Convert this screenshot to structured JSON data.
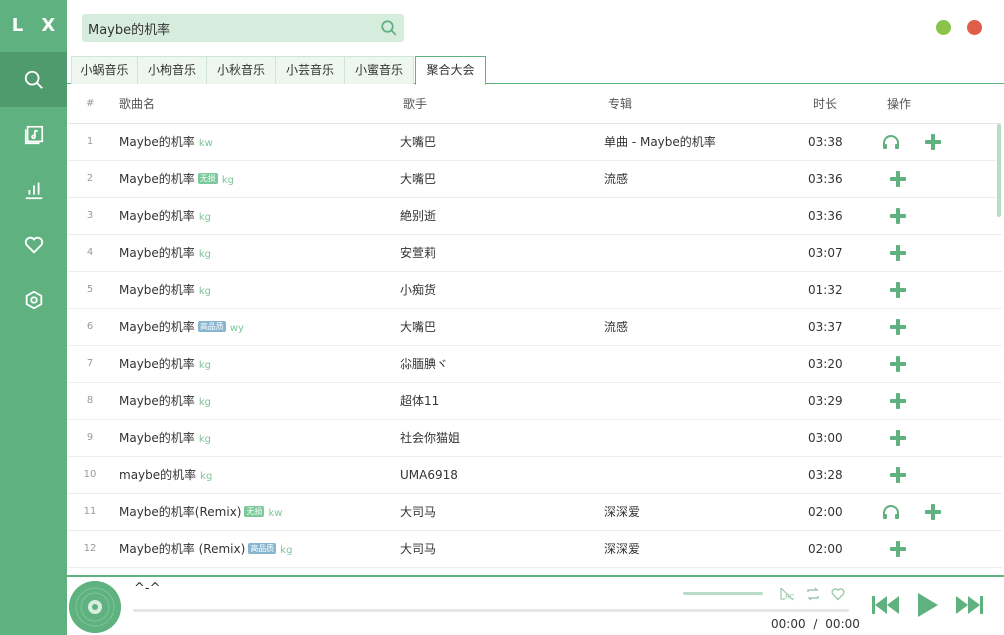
{
  "sidebar": {
    "logo": "L X",
    "items": [
      {
        "name": "search-icon"
      },
      {
        "name": "music-list-icon"
      },
      {
        "name": "chart-icon"
      },
      {
        "name": "heart-icon"
      },
      {
        "name": "settings-icon"
      }
    ]
  },
  "search": {
    "value": "Maybe的机率",
    "placeholder": ""
  },
  "tabs": [
    "小蜗音乐",
    "小枸音乐",
    "小秋音乐",
    "小芸音乐",
    "小蜜音乐",
    "聚合大会"
  ],
  "active_tab": 5,
  "table": {
    "headers": {
      "num": "#",
      "name": "歌曲名",
      "singer": "歌手",
      "album": "专辑",
      "duration": "时长",
      "ops": "操作"
    },
    "rows": [
      {
        "num": "1",
        "name": "Maybe的机率",
        "badge": "",
        "source": "kw",
        "singer": "大嘴巴",
        "album": "单曲 - Maybe的机率",
        "duration": "03:38",
        "listen": true
      },
      {
        "num": "2",
        "name": "Maybe的机率",
        "badge": "无损",
        "source": "kg",
        "singer": "大嘴巴",
        "album": "流感",
        "duration": "03:36",
        "listen": false
      },
      {
        "num": "3",
        "name": "Maybe的机率",
        "badge": "",
        "source": "kg",
        "singer": "絶别逝",
        "album": "",
        "duration": "03:36",
        "listen": false
      },
      {
        "num": "4",
        "name": "Maybe的机率",
        "badge": "",
        "source": "kg",
        "singer": "安萱莉",
        "album": "",
        "duration": "03:07",
        "listen": false
      },
      {
        "num": "5",
        "name": "Maybe的机率",
        "badge": "",
        "source": "kg",
        "singer": "小痴货",
        "album": "",
        "duration": "01:32",
        "listen": false
      },
      {
        "num": "6",
        "name": "Maybe的机率",
        "badge": "高品质",
        "source": "wy",
        "singer": "大嘴巴",
        "album": "流感",
        "duration": "03:37",
        "listen": false
      },
      {
        "num": "7",
        "name": "Maybe的机率",
        "badge": "",
        "source": "kg",
        "singer": "尛腼腆ヾ",
        "album": "",
        "duration": "03:20",
        "listen": false
      },
      {
        "num": "8",
        "name": "Maybe的机率",
        "badge": "",
        "source": "kg",
        "singer": "超体11",
        "album": "",
        "duration": "03:29",
        "listen": false
      },
      {
        "num": "9",
        "name": "Maybe的机率",
        "badge": "",
        "source": "kg",
        "singer": "社会你猫姐",
        "album": "",
        "duration": "03:00",
        "listen": false
      },
      {
        "num": "10",
        "name": "maybe的机率",
        "badge": "",
        "source": "kg",
        "singer": "UMA6918",
        "album": "",
        "duration": "03:28",
        "listen": false
      },
      {
        "num": "11",
        "name": "Maybe的机率(Remix)",
        "badge": "无损",
        "source": "kw",
        "singer": "大司马",
        "album": "深深爱",
        "duration": "02:00",
        "listen": true
      },
      {
        "num": "12",
        "name": "Maybe的机率 (Remix)",
        "badge": "高品质",
        "source": "kg",
        "singer": "大司马",
        "album": "深深爱",
        "duration": "02:00",
        "listen": false
      }
    ]
  },
  "player": {
    "title": "^-^",
    "current_time": "00:00",
    "separator": "/",
    "total_time": "00:00",
    "progress": 0,
    "volume": 1.0
  },
  "colors": {
    "primary": "#5fb17f",
    "primary_dark": "#4f9b6e",
    "min": "#8bc34a",
    "close": "#e05d4a"
  }
}
